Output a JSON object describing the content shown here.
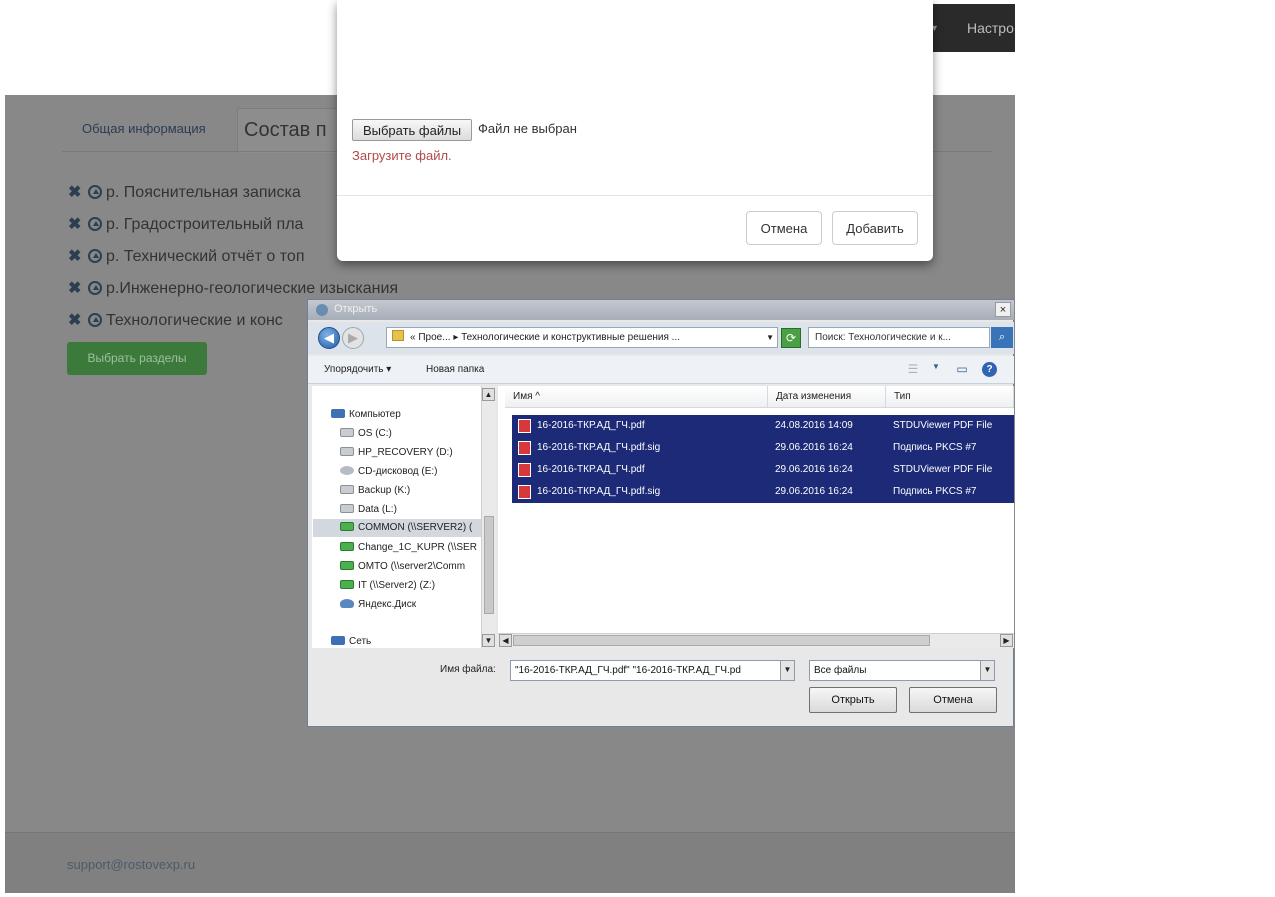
{
  "app": {
    "top_nav_item": "Настро",
    "tabs": [
      "Общая информация",
      "Состав п"
    ],
    "sections": [
      "р. Пояснительная записка",
      "р. Градостроительный пла",
      "р. Технический отчёт о топ",
      "р.Инженерно-геологические изыскания",
      "Технологические и конс"
    ],
    "choose_sections_button": "Выбрать разделы",
    "footer_email": "support@rostovexp.ru"
  },
  "upload_modal": {
    "choose_files_button": "Выбрать файлы",
    "no_file_text": "Файл не выбран",
    "error_text": "Загрузите файл.",
    "cancel_button": "Отмена",
    "add_button": "Добавить"
  },
  "open_dialog": {
    "title": "Открыть",
    "close_glyph": "×",
    "address_path": "« Прое... ▸ Технологические и конструктивные решения ...",
    "search_placeholder": "Поиск: Технологические и к...",
    "organize_label": "Упорядочить ▾",
    "new_folder_label": "Новая папка",
    "nav_items": [
      "Компьютер",
      "OS (C:)",
      "HP_RECOVERY (D:)",
      "CD-дисковод (E:)",
      "Backup (K:)",
      "Data (L:)",
      "COMMON (\\\\SERVER2) (",
      "Change_1C_KUPR (\\\\SER",
      "OMTO (\\\\server2\\Comm",
      "IT (\\\\Server2) (Z:)",
      "Яндекс.Диск",
      "Сеть"
    ],
    "columns": {
      "name": "Имя ^",
      "date": "Дата изменения",
      "type": "Тип"
    },
    "files": [
      {
        "name": "16-2016-ТКР.АД_ГЧ.pdf",
        "date": "24.08.2016 14:09",
        "type": "STDUViewer PDF File"
      },
      {
        "name": "16-2016-ТКР.АД_ГЧ.pdf.sig",
        "date": "29.06.2016 16:24",
        "type": "Подпись PKCS #7"
      },
      {
        "name": "16-2016-ТКР.АД_ГЧ.pdf",
        "date": "29.06.2016 16:24",
        "type": "STDUViewer PDF File"
      },
      {
        "name": "16-2016-ТКР.АД_ГЧ.pdf.sig",
        "date": "29.06.2016 16:24",
        "type": "Подпись PKCS #7"
      }
    ],
    "filename_label": "Имя файла:",
    "filename_value": "\"16-2016-ТКР.АД_ГЧ.pdf\" \"16-2016-ТКР.АД_ГЧ.pd",
    "filter_value": "Все файлы",
    "open_button": "Открыть",
    "cancel_button": "Отмена"
  },
  "colors": {
    "selection": "#1c2a78",
    "overlay": "#888888",
    "error": "#b04a48",
    "green_button": "#3c7a3c"
  }
}
